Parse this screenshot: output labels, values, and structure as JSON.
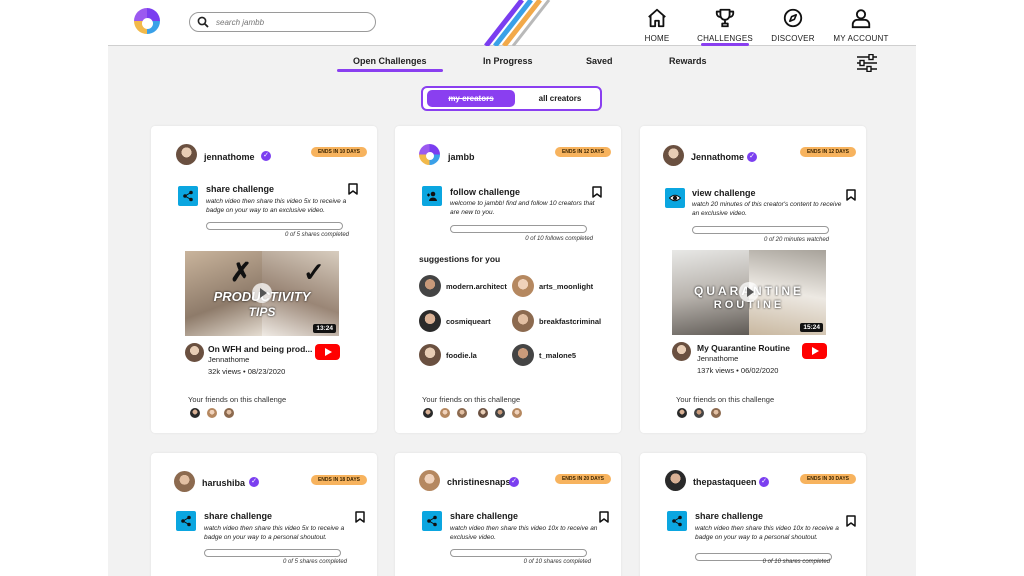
{
  "header": {
    "search_placeholder": "search jambb",
    "nav": [
      {
        "label": "HOME",
        "icon": "home-icon",
        "active": false
      },
      {
        "label": "CHALLENGES",
        "icon": "trophy-icon",
        "active": true
      },
      {
        "label": "DISCOVER",
        "icon": "compass-icon",
        "active": false
      },
      {
        "label": "MY ACCOUNT",
        "icon": "user-icon",
        "active": false
      }
    ]
  },
  "subtabs": [
    "Open Challenges",
    "In Progress",
    "Saved",
    "Rewards"
  ],
  "active_subtab": "Open Challenges",
  "toggle": {
    "option_a": "my creators",
    "option_b": "all creators",
    "selected": "my creators"
  },
  "colors": {
    "accent": "#8a3ff0",
    "badge": "#f7b35e",
    "challenge_icon": "#0ba6e0",
    "youtube": "#ff0000"
  },
  "cards": [
    {
      "creator": "jennathome",
      "verified": true,
      "ends": "ENDS IN 10 DAYS",
      "challenge_title": "share challenge",
      "challenge_desc": "watch video then share this video 5x to receive a badge on your way to an exclusive video.",
      "progress_text": "0 of 5 shares completed",
      "video": {
        "title": "On WFH and being prod...",
        "channel": "Jennathome",
        "meta": "32k views • 08/23/2020",
        "duration": "13:24",
        "overlay_line1": "PRODUCTIVITY",
        "overlay_line2": "TIPS"
      },
      "friends_label": "Your friends on this challenge"
    },
    {
      "creator": "jambb",
      "verified": false,
      "ends": "ENDS IN 12 DAYS",
      "challenge_title": "follow challenge",
      "challenge_desc": "welcome to jambb! find and follow 10 creators that are new to you.",
      "progress_text": "0 of 10 follows completed",
      "suggestions_label": "suggestions for you",
      "suggestions": [
        "modern.architect",
        "arts_moonlight",
        "cosmiqueart",
        "breakfastcriminal",
        "foodie.la",
        "t_malone5"
      ],
      "friends_label": "Your friends on this challenge"
    },
    {
      "creator": "Jennathome",
      "verified": true,
      "ends": "ENDS IN 12 DAYS",
      "challenge_title": "view challenge",
      "challenge_desc": "watch 20 minutes of this creator's content to receive an exclusive video.",
      "progress_text": "0 of 20 minutes watched",
      "video": {
        "title": "My Quarantine Routine",
        "channel": "Jennathome",
        "meta": "137k views • 06/02/2020",
        "duration": "15:24",
        "overlay_line1": "QUARANTINE",
        "overlay_line2": "ROUTINE"
      },
      "friends_label": "Your friends on this challenge"
    },
    {
      "creator": "harushiba",
      "verified": true,
      "ends": "ENDS IN 18 DAYS",
      "challenge_title": "share challenge",
      "challenge_desc": "watch video then share this video 5x to receive a badge on your way to a personal shoutout.",
      "progress_text": "0 of 5 shares completed"
    },
    {
      "creator": "christinesnaps",
      "verified": true,
      "ends": "ENDS IN 20 DAYS",
      "challenge_title": "share challenge",
      "challenge_desc": "watch video then share this video 10x to receive an exclusive video.",
      "progress_text": "0 of 10 shares completed"
    },
    {
      "creator": "thepastaqueen",
      "verified": true,
      "ends": "ENDS IN 30 DAYS",
      "challenge_title": "share challenge",
      "challenge_desc": "watch video then share this video 10x to receive a badge on your way to a personal shoutout.",
      "progress_text": "0 of 10 shares completed"
    }
  ]
}
